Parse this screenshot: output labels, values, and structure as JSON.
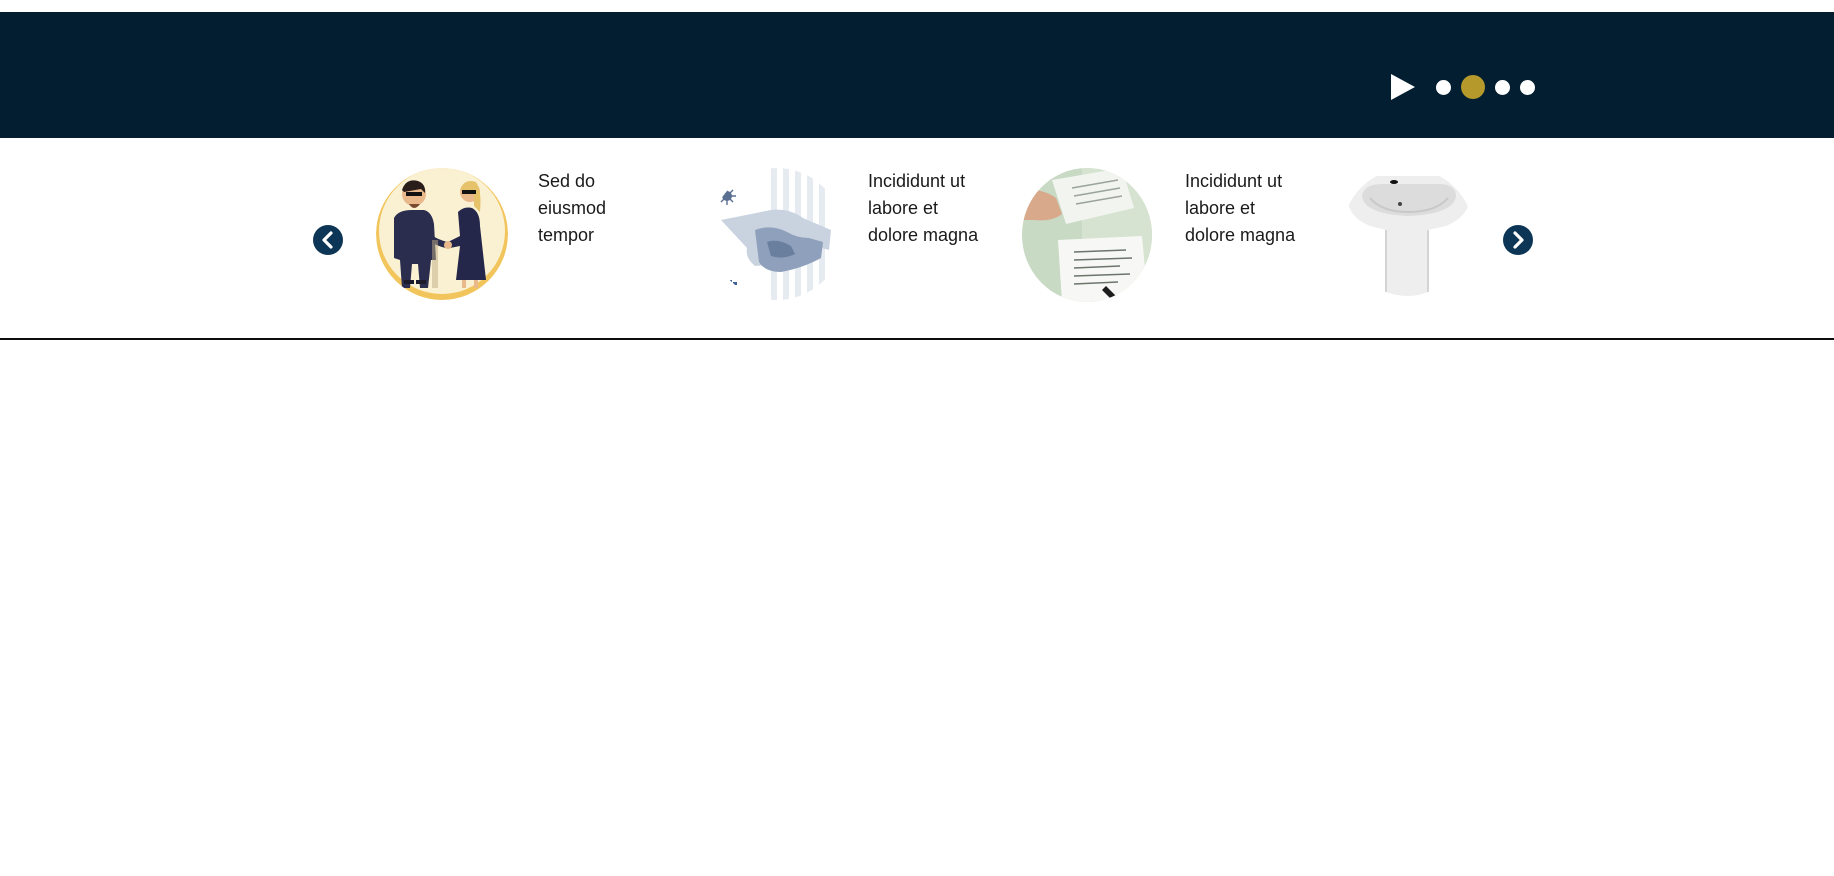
{
  "banner": {
    "background": "#041e31",
    "controls": {
      "play_icon": "play-icon",
      "dots": [
        {
          "active": false
        },
        {
          "active": true
        },
        {
          "active": false
        },
        {
          "active": false
        }
      ],
      "accent_color": "#b5992b"
    }
  },
  "carousel": {
    "prev_icon": "chevron-left-icon",
    "next_icon": "chevron-right-icon",
    "arrow_color": "#0d3555",
    "items": [
      {
        "caption": "Sed do eiusmod tempor",
        "image": "business-handshake-illustration"
      },
      {
        "caption": "Incididunt ut labore et dolore magna",
        "image": "handshake-photo"
      },
      {
        "caption": "Incididunt ut labore et dolore magna",
        "image": "contract-signing-photo"
      },
      {
        "caption": "",
        "image": "washbasin-photo"
      }
    ]
  }
}
